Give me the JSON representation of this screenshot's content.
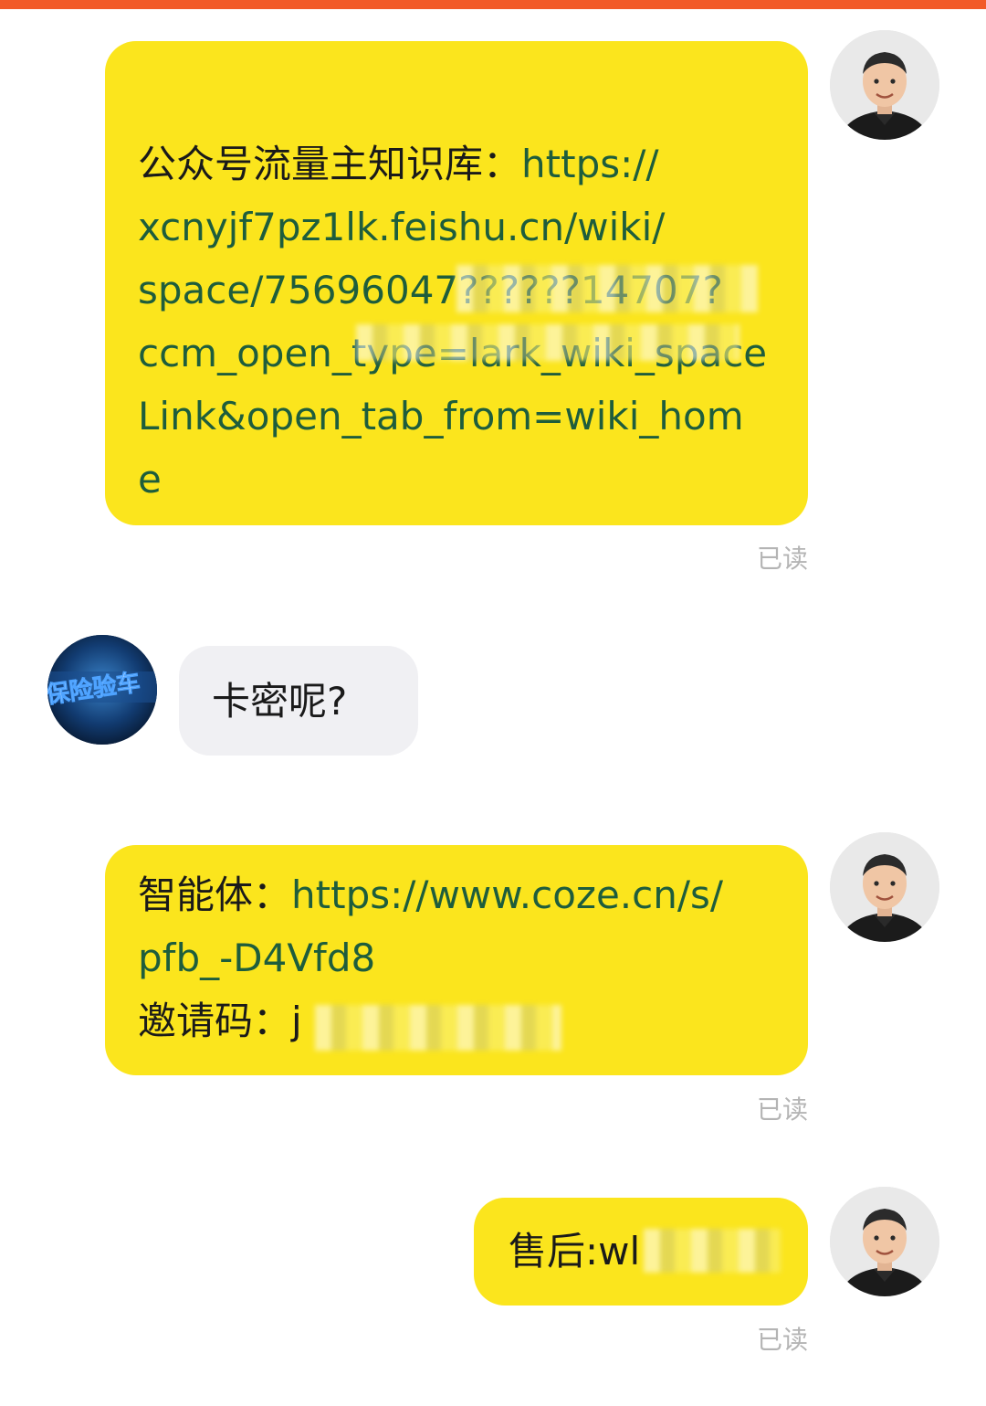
{
  "messages": [
    {
      "label": "公众号流量主知识库：",
      "url_lines": [
        "https://",
        "xcnyjf7pz1lk.feishu.cn/wiki/",
        "space/75696047??????14707?",
        "ccm_open_type=lark_wiki_space",
        "Link&open_tab_from=wiki_hom",
        "e"
      ],
      "status": "已读"
    },
    {
      "text": "卡密呢?"
    },
    {
      "label": "智能体：",
      "url_line1": "https://www.coze.cn/s/",
      "url_line2": "pfb_-D4Vfd8",
      "invite_label": "邀请码：",
      "invite_value": "j",
      "status": "已读"
    },
    {
      "text": "售后:wl",
      "status": "已读"
    }
  ],
  "icons": {
    "self_avatar": "user-avatar-icon",
    "other_avatar": "contact-avatar-icon"
  },
  "colors": {
    "accent_bar": "#f25a28",
    "outgoing_bubble": "#fbe51d",
    "incoming_bubble": "#f0f0f3",
    "link": "#1e5d3c",
    "read_status": "#b4b4b4"
  }
}
